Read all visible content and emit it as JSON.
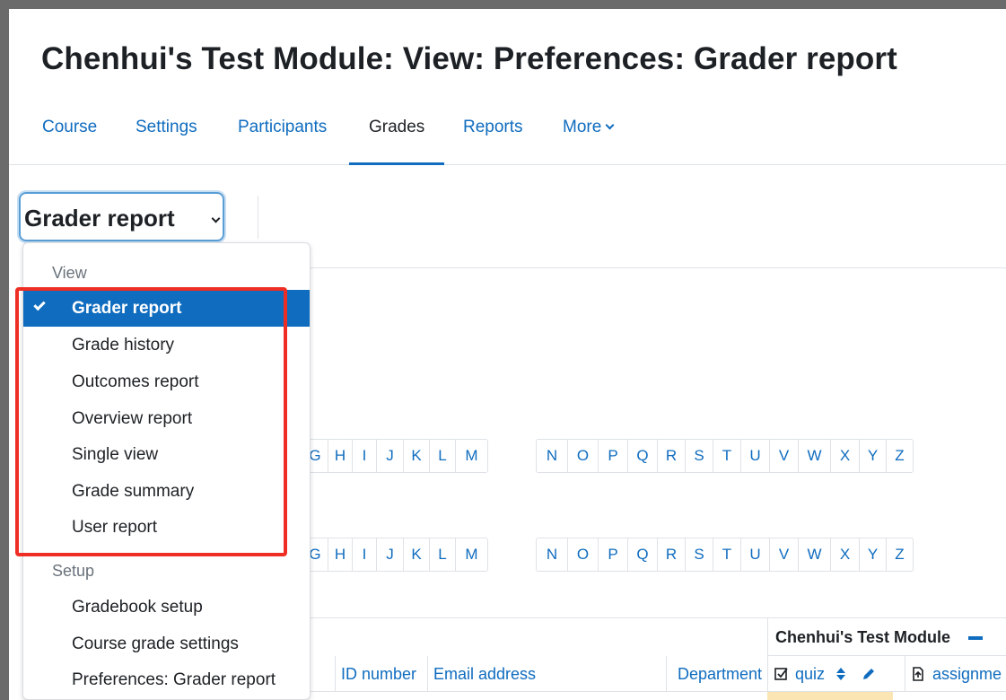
{
  "page": {
    "title": "Chenhui's Test Module: View: Preferences: Grader report"
  },
  "nav": {
    "items": [
      {
        "label": "Course"
      },
      {
        "label": "Settings"
      },
      {
        "label": "Participants"
      },
      {
        "label": "Grades"
      },
      {
        "label": "Reports"
      },
      {
        "label": "More"
      }
    ],
    "active": "Grades"
  },
  "report_selector": {
    "label": "Grader report"
  },
  "dropdown": {
    "groups": [
      {
        "heading": "View",
        "items": [
          {
            "label": "Grader report"
          },
          {
            "label": "Grade history"
          },
          {
            "label": "Outcomes report"
          },
          {
            "label": "Overview report"
          },
          {
            "label": "Single view"
          },
          {
            "label": "Grade summary"
          },
          {
            "label": "User report"
          }
        ]
      },
      {
        "heading": "Setup",
        "items": [
          {
            "label": "Gradebook setup"
          },
          {
            "label": "Course grade settings"
          },
          {
            "label": "Preferences: Grader report"
          }
        ]
      }
    ],
    "selected": "Grader report"
  },
  "letter_filter": {
    "first_group_visible": [
      "G",
      "H",
      "I",
      "J",
      "K",
      "L",
      "M"
    ],
    "second_group": [
      "N",
      "O",
      "P",
      "Q",
      "R",
      "S",
      "T",
      "U",
      "V",
      "W",
      "X",
      "Y",
      "Z"
    ]
  },
  "table": {
    "module_header": "Chenhui's Test Module",
    "columns": [
      {
        "label": "ID number"
      },
      {
        "label": "Email address"
      },
      {
        "label": "Department"
      },
      {
        "label": "quiz"
      },
      {
        "label": "assignme"
      }
    ]
  },
  "colors": {
    "link": "#0f6cbf",
    "selected_bg": "#0f6cbf",
    "highlight": "#ee2e24",
    "row_band": "#fbe6b3"
  }
}
